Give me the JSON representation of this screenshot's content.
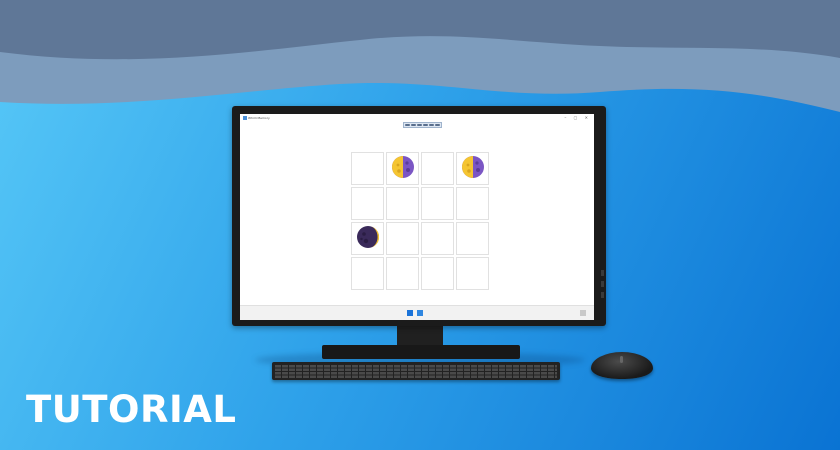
{
  "banner": {
    "label": "TUTORIAL"
  },
  "colors": {
    "background_light": "#57c8f7",
    "background_dark": "#0a73d3",
    "wave_dark": "#5f7696",
    "wave_light": "#7a9bbd",
    "moon_yellow": "#f5c531",
    "moon_purple": "#7b56c4",
    "moon_dark": "#3a2a5a"
  },
  "app": {
    "title": "Whirli Memory",
    "toolbar_icons": [
      "undo-icon",
      "restart-icon",
      "hint-icon",
      "pause-icon",
      "settings-icon",
      "close-icon"
    ]
  },
  "board": {
    "rows": 4,
    "cols": 4,
    "tiles": [
      "",
      "first-quarter-moon-icon",
      "",
      "first-quarter-moon-icon",
      "",
      "",
      "",
      "",
      "waxing-crescent-moon-icon",
      "",
      "",
      "",
      "",
      "",
      "",
      ""
    ]
  },
  "taskbar": {
    "icons": [
      "windows-start-icon",
      "app-icon",
      "tray-icon"
    ]
  }
}
